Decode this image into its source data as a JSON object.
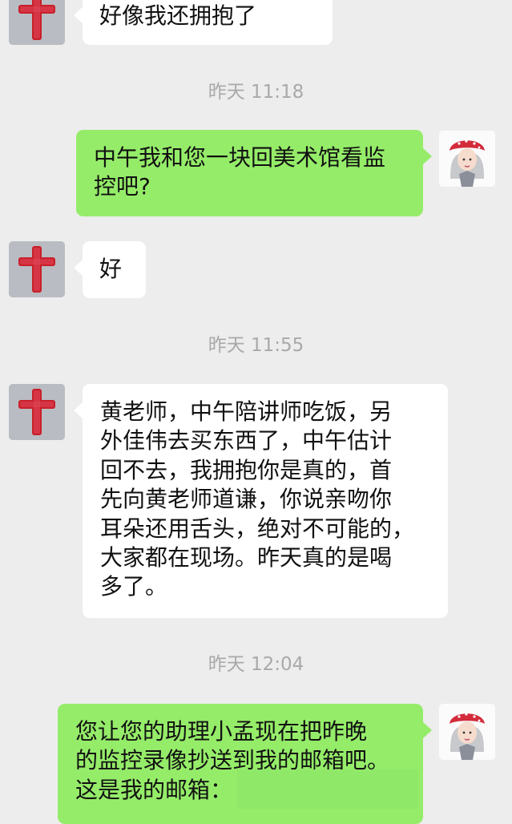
{
  "colors": {
    "background": "#ededed",
    "outgoing_bubble": "#95ec69",
    "incoming_bubble": "#ffffff",
    "timestamp_text": "#a9a9a9",
    "contact_avatar_cross": "#c8202a"
  },
  "icons": {
    "contact_avatar": "red-cross-avatar-icon",
    "my_avatar": "girl-red-beret-avatar-icon"
  },
  "chat": {
    "msg1": {
      "text": "好像我还拥抱了"
    },
    "time1": "昨天 11:18",
    "msg2": {
      "text": "中午我和您一块回美术馆看监\n控吧?"
    },
    "msg3": {
      "text": "好"
    },
    "time2": "昨天 11:55",
    "msg4": {
      "text": "黄老师，中午陪讲师吃饭，另\n外佳伟去买东西了，中午估计\n回不去，我拥抱你是真的，首\n先向黄老师道谦，你说亲吻你\n耳朵还用舌头，绝对不可能的，\n大家都在现场。昨天真的是喝\n多了。"
    },
    "time3": "昨天 12:04",
    "msg5": {
      "text": "您让您的助理小孟现在把昨晚\n的监控录像抄送到我的邮箱吧。\n这是我的邮箱："
    }
  }
}
